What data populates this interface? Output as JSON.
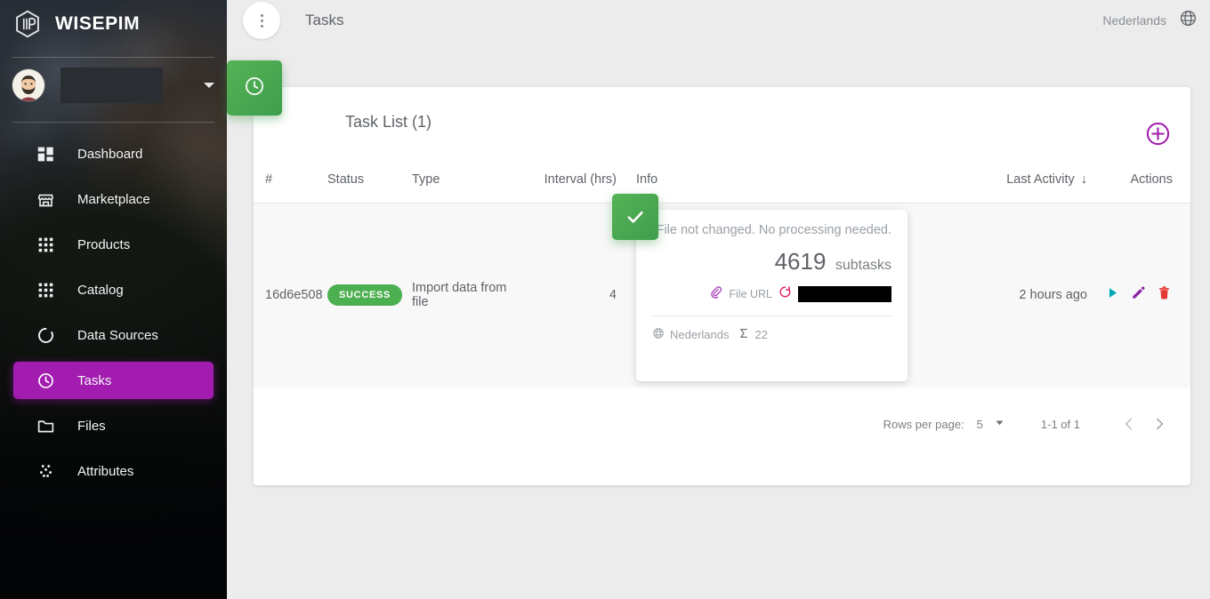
{
  "sidebar": {
    "brand": "WISEPIM",
    "user_name": "",
    "items": [
      {
        "label": "Dashboard",
        "icon": "dashboard-icon",
        "active": false
      },
      {
        "label": "Marketplace",
        "icon": "store-icon",
        "active": false
      },
      {
        "label": "Products",
        "icon": "grid-icon",
        "active": false
      },
      {
        "label": "Catalog",
        "icon": "grid-icon",
        "active": false
      },
      {
        "label": "Data Sources",
        "icon": "loading-ring-icon",
        "active": false
      },
      {
        "label": "Tasks",
        "icon": "clock-icon",
        "active": true
      },
      {
        "label": "Files",
        "icon": "folder-icon",
        "active": false
      },
      {
        "label": "Attributes",
        "icon": "dots-scatter-icon",
        "active": false
      }
    ]
  },
  "topbar": {
    "page_title": "Tasks",
    "language": "Nederlands",
    "menu_icon": "kebab-menu-icon",
    "globe_icon": "globe-icon"
  },
  "card": {
    "title": "Task List (1)",
    "badge_icon": "clock-icon",
    "add_label": "+"
  },
  "table": {
    "headers": {
      "id": "#",
      "status": "Status",
      "type": "Type",
      "interval": "Interval (hrs)",
      "info": "Info",
      "last_activity": "Last Activity",
      "sort_arrow": "↓",
      "actions": "Actions"
    },
    "rows": [
      {
        "id": "16d6e508",
        "status": "SUCCESS",
        "type": "Import data from file",
        "interval": "4",
        "info": {
          "message": "File not changed. No processing needed.",
          "count": "4619",
          "count_unit": "subtasks",
          "url_label": "File URL",
          "url_value": "",
          "language": "Nederlands",
          "sum_value": "22"
        },
        "last_activity": "2 hours ago",
        "actions": [
          "run-icon",
          "edit-icon",
          "delete-icon"
        ]
      }
    ]
  },
  "pagination": {
    "rows_per_page_label": "Rows per page:",
    "rows_per_page_value": "5",
    "range": "1-1 of 1",
    "prev": "‹",
    "next": "›"
  },
  "colors": {
    "accent_purple": "#a21caf",
    "success_green": "#4caf50",
    "delete_red": "#e53935",
    "run_teal": "#00a8b5",
    "edit_purple": "#8e24aa",
    "url_pink": "#e91e63"
  }
}
